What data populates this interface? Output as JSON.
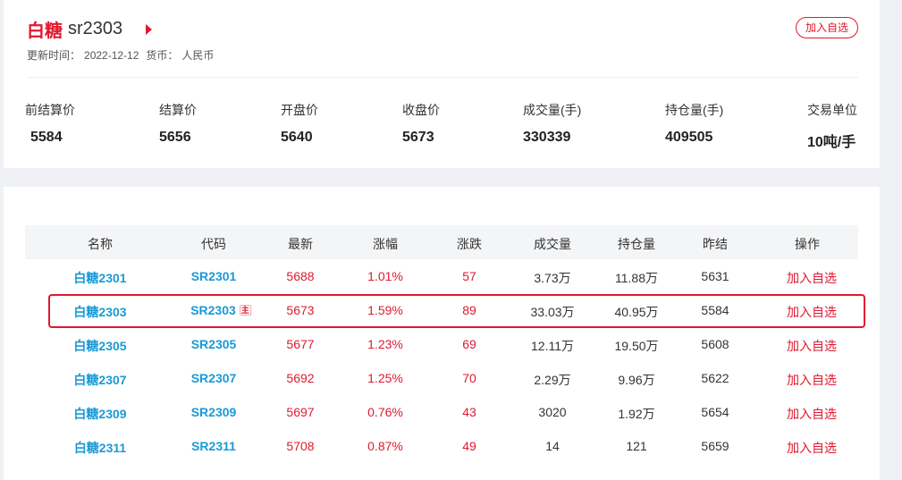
{
  "header": {
    "name": "白糖",
    "code": "sr2303",
    "update_label": "更新时间：",
    "update_time": "2022-12-12",
    "currency_label": "货币：",
    "currency": "人民币",
    "add_button": "加入自选"
  },
  "stats": [
    {
      "label": "前结算价",
      "value": "5584"
    },
    {
      "label": "结算价",
      "value": "5656"
    },
    {
      "label": "开盘价",
      "value": "5640"
    },
    {
      "label": "收盘价",
      "value": "5673"
    },
    {
      "label": "成交量(手)",
      "value": "330339"
    },
    {
      "label": "持仓量(手)",
      "value": "409505"
    },
    {
      "label": "交易单位",
      "value": "10吨/手"
    }
  ],
  "table": {
    "columns": [
      "名称",
      "代码",
      "最新",
      "涨幅",
      "涨跌",
      "成交量",
      "持仓量",
      "昨结",
      "操作"
    ],
    "main_tag": "主",
    "rows": [
      {
        "name": "白糖2301",
        "code": "SR2301",
        "latest": "5688",
        "pct": "1.01%",
        "change": "57",
        "volume": "3.73万",
        "oi": "11.88万",
        "prev": "5631",
        "op": "加入自选"
      },
      {
        "name": "白糖2303",
        "code": "SR2303",
        "latest": "5673",
        "pct": "1.59%",
        "change": "89",
        "volume": "33.03万",
        "oi": "40.95万",
        "prev": "5584",
        "op": "加入自选"
      },
      {
        "name": "白糖2305",
        "code": "SR2305",
        "latest": "5677",
        "pct": "1.23%",
        "change": "69",
        "volume": "12.11万",
        "oi": "19.50万",
        "prev": "5608",
        "op": "加入自选"
      },
      {
        "name": "白糖2307",
        "code": "SR2307",
        "latest": "5692",
        "pct": "1.25%",
        "change": "70",
        "volume": "2.29万",
        "oi": "9.96万",
        "prev": "5622",
        "op": "加入自选"
      },
      {
        "name": "白糖2309",
        "code": "SR2309",
        "latest": "5697",
        "pct": "0.76%",
        "change": "43",
        "volume": "3020",
        "oi": "1.92万",
        "prev": "5654",
        "op": "加入自选"
      },
      {
        "name": "白糖2311",
        "code": "SR2311",
        "latest": "5708",
        "pct": "0.87%",
        "change": "49",
        "volume": "14",
        "oi": "121",
        "prev": "5659",
        "op": "加入自选"
      }
    ]
  }
}
